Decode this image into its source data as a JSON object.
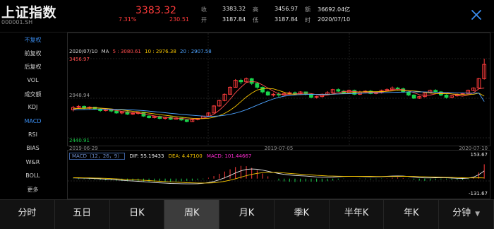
{
  "header": {
    "title": "上证指数",
    "code": "000001.SH",
    "price": "3383.32",
    "change_pct": "7.31%",
    "change": "230.51",
    "quote": [
      {
        "label": "收",
        "value": "3383.32"
      },
      {
        "label": "高",
        "value": "3456.97"
      },
      {
        "label": "额",
        "value": "36692.04亿"
      },
      {
        "label": "开",
        "value": "3187.84"
      },
      {
        "label": "低",
        "value": "3187.84"
      },
      {
        "label": "时",
        "value": "2020/07/10"
      }
    ],
    "close_icon": "close-icon"
  },
  "sidebar": {
    "items": [
      {
        "label": "不复权",
        "active": true
      },
      {
        "label": "前复权",
        "active": false
      },
      {
        "label": "后复权",
        "active": false
      },
      {
        "label": "VOL",
        "active": false
      },
      {
        "label": "成交额",
        "active": false
      },
      {
        "label": "KDJ",
        "active": false
      },
      {
        "label": "MACD",
        "active": true
      },
      {
        "label": "RSI",
        "active": false
      },
      {
        "label": "BIAS",
        "active": false
      },
      {
        "label": "W&R",
        "active": false
      },
      {
        "label": "BOLL",
        "active": false
      },
      {
        "label": "更多",
        "active": false
      }
    ]
  },
  "chart": {
    "date": "2020/07/10",
    "ma_label": "MA",
    "ma": [
      {
        "label": "5 : 3080.61",
        "color": "#ff4d4d"
      },
      {
        "label": "10 : 2976.38",
        "color": "#f5c400"
      },
      {
        "label": "20 : 2907.58",
        "color": "#4da3ff"
      }
    ],
    "price_high": "3456.97",
    "price_mid": "2948.94",
    "price_low": "2440.91",
    "x_dates": [
      "2019-06-29",
      "2019-07-05",
      "2020-07-10"
    ],
    "macd": {
      "box_label": "MACD（12，26，9）",
      "dif": "DIF: 55.19433",
      "dea": "DEA: 4.47100",
      "macd": "MACD: 101.44667",
      "max": "153.67",
      "min": "-131.67"
    },
    "colors": {
      "up": "#ff3b3b",
      "down": "#19d24b",
      "dif": "#e8e8e8",
      "dea": "#f5c400",
      "macd": "#ff2bd1"
    }
  },
  "chart_data": {
    "type": "candlestick",
    "title": "",
    "ylim": [
      2440.91,
      3456.97
    ],
    "x_ticks": [
      "2019-06-29",
      "2019-07-05",
      "2020-07-10"
    ],
    "candles": [
      [
        2800,
        2830,
        2780,
        2850
      ],
      [
        2830,
        2845,
        2815,
        2860
      ],
      [
        2845,
        2820,
        2810,
        2855
      ],
      [
        2820,
        2835,
        2805,
        2845
      ],
      [
        2835,
        2810,
        2800,
        2840
      ],
      [
        2810,
        2790,
        2775,
        2820
      ],
      [
        2790,
        2805,
        2780,
        2815
      ],
      [
        2805,
        2785,
        2770,
        2815
      ],
      [
        2785,
        2760,
        2750,
        2795
      ],
      [
        2760,
        2775,
        2745,
        2780
      ],
      [
        2775,
        2745,
        2735,
        2785
      ],
      [
        2745,
        2755,
        2735,
        2770
      ],
      [
        2755,
        2770,
        2740,
        2780
      ],
      [
        2770,
        2720,
        2710,
        2775
      ],
      [
        2720,
        2700,
        2690,
        2730
      ],
      [
        2700,
        2715,
        2690,
        2725
      ],
      [
        2715,
        2690,
        2680,
        2725
      ],
      [
        2690,
        2705,
        2675,
        2710
      ],
      [
        2705,
        2680,
        2670,
        2715
      ],
      [
        2680,
        2695,
        2675,
        2705
      ],
      [
        2695,
        2670,
        2660,
        2700
      ],
      [
        2670,
        2650,
        2640,
        2675
      ],
      [
        2650,
        2675,
        2645,
        2685
      ],
      [
        2675,
        2690,
        2665,
        2695
      ],
      [
        2690,
        2720,
        2685,
        2725
      ],
      [
        2720,
        2760,
        2715,
        2770
      ],
      [
        2760,
        2850,
        2755,
        2860
      ],
      [
        2850,
        2920,
        2840,
        2930
      ],
      [
        2920,
        3000,
        2910,
        3010
      ],
      [
        3000,
        3090,
        2995,
        3100
      ],
      [
        3090,
        3180,
        3085,
        3195
      ],
      [
        3180,
        3160,
        3130,
        3200
      ],
      [
        3160,
        3200,
        3150,
        3215
      ],
      [
        3200,
        3140,
        3120,
        3210
      ],
      [
        3140,
        3090,
        3070,
        3150
      ],
      [
        3090,
        3030,
        3010,
        3100
      ],
      [
        3030,
        2990,
        2980,
        3045
      ],
      [
        2990,
        3000,
        2970,
        3020
      ],
      [
        3000,
        2990,
        2960,
        3030
      ],
      [
        2990,
        3010,
        2980,
        3030
      ],
      [
        3010,
        3020,
        3000,
        3035
      ],
      [
        3020,
        3005,
        2995,
        3035
      ],
      [
        3005,
        3030,
        2995,
        3040
      ],
      [
        3030,
        3000,
        2985,
        3035
      ],
      [
        3000,
        2960,
        2950,
        3010
      ],
      [
        2960,
        2970,
        2945,
        2980
      ],
      [
        2970,
        3000,
        2960,
        3010
      ],
      [
        3000,
        3020,
        2990,
        3040
      ],
      [
        3020,
        3060,
        3010,
        3070
      ],
      [
        3060,
        3040,
        3030,
        3075
      ],
      [
        3040,
        3020,
        3010,
        3055
      ],
      [
        3020,
        3050,
        3010,
        3060
      ],
      [
        3050,
        3000,
        2990,
        3060
      ],
      [
        3000,
        3030,
        2990,
        3045
      ],
      [
        3030,
        3040,
        3020,
        3050
      ],
      [
        3040,
        3010,
        3000,
        3055
      ],
      [
        3010,
        3020,
        3000,
        3030
      ],
      [
        3020,
        3050,
        3010,
        3060
      ],
      [
        3050,
        3060,
        3040,
        3075
      ],
      [
        3060,
        3080,
        3050,
        3100
      ],
      [
        3080,
        3070,
        3055,
        3095
      ],
      [
        3070,
        3030,
        3020,
        3085
      ],
      [
        3030,
        2990,
        2975,
        3040
      ],
      [
        2990,
        2950,
        2940,
        3000
      ],
      [
        2950,
        2970,
        2940,
        2980
      ],
      [
        2970,
        3020,
        2960,
        3030
      ],
      [
        3020,
        3050,
        3010,
        3060
      ],
      [
        3050,
        3030,
        3020,
        3065
      ],
      [
        3030,
        2990,
        2975,
        3040
      ],
      [
        2990,
        2960,
        2945,
        3000
      ],
      [
        2960,
        2980,
        2950,
        2990
      ],
      [
        2980,
        3000,
        2970,
        3010
      ],
      [
        3000,
        3010,
        2990,
        3020
      ],
      [
        3010,
        3050,
        3000,
        3060
      ],
      [
        3050,
        3080,
        3040,
        3090
      ],
      [
        3080,
        3200,
        3070,
        3210
      ],
      [
        3200,
        3383.32,
        3187.84,
        3456.97
      ]
    ],
    "series": [
      {
        "name": "5",
        "values": [
          2810,
          2818,
          2825,
          2826,
          2828,
          2822,
          2812,
          2800,
          2793,
          2780,
          2772,
          2765,
          2758,
          2750,
          2738,
          2722,
          2712,
          2702,
          2698,
          2692,
          2690,
          2682,
          2680,
          2682,
          2690,
          2710,
          2745,
          2795,
          2860,
          2935,
          3020,
          3090,
          3150,
          3165,
          3155,
          3120,
          3080,
          3040,
          3005,
          2995,
          3000,
          3005,
          3010,
          3015,
          3010,
          2995,
          2985,
          2990,
          3005,
          3020,
          3035,
          3040,
          3035,
          3030,
          3025,
          3025,
          3025,
          3030,
          3040,
          3055,
          3065,
          3060,
          3045,
          3020,
          2995,
          2985,
          2990,
          3005,
          3020,
          3020,
          3005,
          2985,
          2975,
          2990,
          3020,
          3070,
          3080.61
        ]
      },
      {
        "name": "10",
        "values": [
          2815,
          2818,
          2820,
          2822,
          2824,
          2822,
          2818,
          2812,
          2806,
          2798,
          2790,
          2782,
          2775,
          2768,
          2758,
          2748,
          2738,
          2730,
          2722,
          2714,
          2706,
          2698,
          2692,
          2688,
          2688,
          2692,
          2705,
          2725,
          2755,
          2795,
          2845,
          2905,
          2965,
          3015,
          3055,
          3070,
          3075,
          3070,
          3050,
          3025,
          3005,
          2998,
          2996,
          2998,
          3000,
          3000,
          2998,
          2998,
          3000,
          3005,
          3012,
          3020,
          3025,
          3030,
          3032,
          3033,
          3033,
          3035,
          3038,
          3042,
          3046,
          3048,
          3046,
          3042,
          3035,
          3025,
          3015,
          3010,
          3008,
          3008,
          3005,
          3000,
          2995,
          2995,
          3000,
          3015,
          2976.38
        ]
      },
      {
        "name": "20",
        "values": [
          2800,
          2802,
          2804,
          2806,
          2808,
          2809,
          2810,
          2809,
          2808,
          2806,
          2803,
          2799,
          2795,
          2790,
          2784,
          2777,
          2770,
          2763,
          2756,
          2749,
          2742,
          2736,
          2730,
          2725,
          2720,
          2718,
          2718,
          2722,
          2730,
          2742,
          2758,
          2778,
          2802,
          2830,
          2860,
          2888,
          2915,
          2940,
          2960,
          2975,
          2985,
          2992,
          2996,
          2998,
          2999,
          3000,
          3000,
          3001,
          3002,
          3004,
          3006,
          3008,
          3010,
          3012,
          3014,
          3016,
          3018,
          3020,
          3022,
          3024,
          3026,
          3028,
          3030,
          3031,
          3031,
          3030,
          3029,
          3027,
          3025,
          3023,
          3021,
          3018,
          3016,
          3014,
          3014,
          3016,
          2907.58
        ]
      }
    ],
    "macd": {
      "dif": [
        5,
        4,
        3,
        2,
        0,
        -2,
        -4,
        -6,
        -9,
        -12,
        -15,
        -17,
        -19,
        -22,
        -25,
        -28,
        -30,
        -32,
        -34,
        -35,
        -36,
        -37,
        -37,
        -36,
        -33,
        -28,
        -20,
        -8,
        6,
        22,
        40,
        55,
        65,
        68,
        66,
        60,
        52,
        44,
        36,
        30,
        26,
        22,
        20,
        18,
        15,
        12,
        10,
        10,
        11,
        13,
        15,
        16,
        16,
        15,
        14,
        13,
        13,
        14,
        16,
        18,
        19,
        18,
        15,
        11,
        7,
        5,
        5,
        6,
        7,
        6,
        4,
        2,
        1,
        3,
        10,
        28,
        55.19
      ],
      "dea": [
        6,
        6,
        5,
        5,
        4,
        3,
        2,
        0,
        -2,
        -4,
        -6,
        -8,
        -10,
        -12,
        -14,
        -17,
        -19,
        -21,
        -23,
        -25,
        -27,
        -29,
        -30,
        -31,
        -31,
        -31,
        -29,
        -25,
        -19,
        -11,
        -1,
        10,
        21,
        30,
        37,
        42,
        44,
        44,
        43,
        40,
        37,
        34,
        31,
        28,
        26,
        23,
        21,
        19,
        18,
        17,
        16,
        16,
        16,
        16,
        16,
        16,
        15,
        15,
        15,
        15,
        15,
        16,
        16,
        15,
        14,
        13,
        12,
        11,
        10,
        9,
        8,
        7,
        6,
        5,
        5,
        6,
        4.47
      ],
      "hist": [
        -2,
        -4,
        -4,
        -6,
        -8,
        -10,
        -12,
        -12,
        -14,
        -16,
        -18,
        -18,
        -18,
        -20,
        -22,
        -22,
        -22,
        -22,
        -22,
        -20,
        -18,
        -16,
        -14,
        -10,
        -4,
        6,
        18,
        34,
        50,
        66,
        82,
        90,
        88,
        76,
        58,
        36,
        16,
        0,
        -14,
        -20,
        -22,
        -24,
        -22,
        -20,
        -22,
        -22,
        -22,
        -18,
        -14,
        -8,
        -2,
        0,
        0,
        -2,
        -4,
        -6,
        -4,
        -2,
        2,
        6,
        8,
        4,
        -2,
        -8,
        -14,
        -16,
        -14,
        -10,
        -6,
        -6,
        -8,
        -10,
        -10,
        -4,
        10,
        44,
        101.45
      ]
    }
  },
  "tabs": [
    {
      "label": "分时",
      "active": false
    },
    {
      "label": "五日",
      "active": false
    },
    {
      "label": "日K",
      "active": false
    },
    {
      "label": "周K",
      "active": true
    },
    {
      "label": "月K",
      "active": false
    },
    {
      "label": "季K",
      "active": false
    },
    {
      "label": "半年K",
      "active": false
    },
    {
      "label": "年K",
      "active": false
    },
    {
      "label": "分钟",
      "active": false,
      "dropdown": true
    }
  ]
}
